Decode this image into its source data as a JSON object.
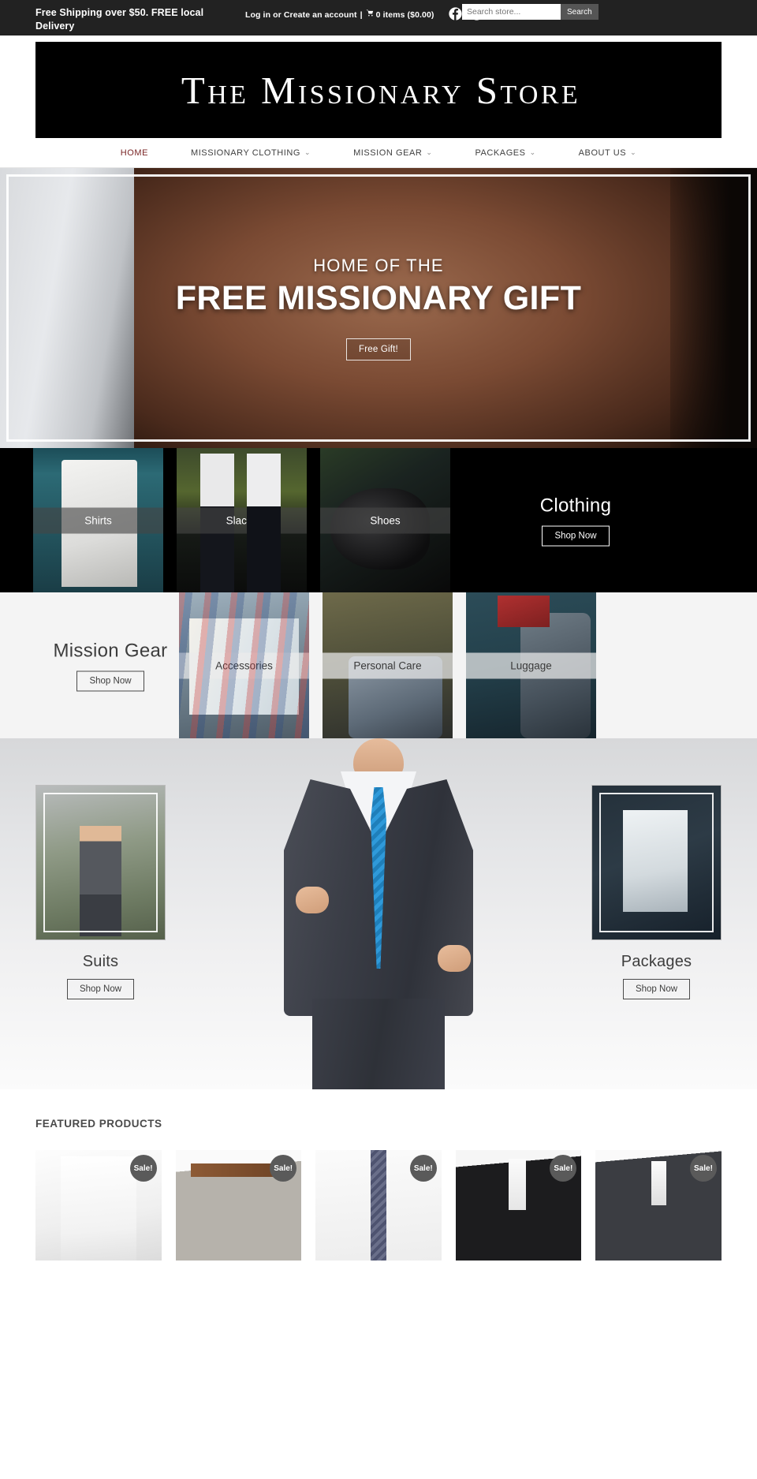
{
  "topbar": {
    "promo": "Free Shipping over $50. FREE local Delivery",
    "login": "Log in",
    "or": " or ",
    "create_account": "Create an account",
    "separator": "|",
    "cart_icon": "shopping-cart-icon",
    "cart_text": "0 items ($0.00)",
    "social": [
      {
        "name": "facebook-icon",
        "label": "Facebook"
      },
      {
        "name": "instagram-icon",
        "label": "Instagram"
      }
    ],
    "search_placeholder": "Search store...",
    "search_value": "",
    "search_button": "Search"
  },
  "header": {
    "logo_text": "The Missionary Store"
  },
  "nav": {
    "items": [
      {
        "label": "HOME",
        "has_caret": false,
        "active": true
      },
      {
        "label": "MISSIONARY CLOTHING",
        "has_caret": true,
        "active": false
      },
      {
        "label": "MISSION GEAR",
        "has_caret": true,
        "active": false
      },
      {
        "label": "PACKAGES",
        "has_caret": true,
        "active": false
      },
      {
        "label": "ABOUT US",
        "has_caret": true,
        "active": false
      }
    ],
    "caret_glyph": "⌄"
  },
  "hero": {
    "subtitle": "HOME OF THE",
    "title": "FREE MISSIONARY GIFT",
    "button": "Free Gift!"
  },
  "clothing": {
    "title": "Clothing",
    "shop_now": "Shop Now",
    "tiles": [
      {
        "label": "Shirts"
      },
      {
        "label": "Slacks"
      },
      {
        "label": "Shoes"
      }
    ]
  },
  "mission_gear": {
    "title": "Mission Gear",
    "shop_now": "Shop Now",
    "tiles": [
      {
        "label": "Accessories"
      },
      {
        "label": "Personal Care"
      },
      {
        "label": "Luggage"
      }
    ]
  },
  "mid": {
    "suits": {
      "title": "Suits",
      "shop_now": "Shop Now"
    },
    "packages": {
      "title": "Packages",
      "shop_now": "Shop Now"
    }
  },
  "featured": {
    "heading": "FEATURED PRODUCTS",
    "sale_badge": "Sale!",
    "products": [
      {
        "badge": "Sale!"
      },
      {
        "badge": "Sale!"
      },
      {
        "badge": "Sale!"
      },
      {
        "badge": "Sale!"
      },
      {
        "badge": "Sale!"
      }
    ]
  },
  "colors": {
    "topbar_bg": "#222222",
    "accent_active": "#7a2525",
    "logo_bg": "#000000",
    "sale_badge_bg": "#5a5a5a"
  }
}
